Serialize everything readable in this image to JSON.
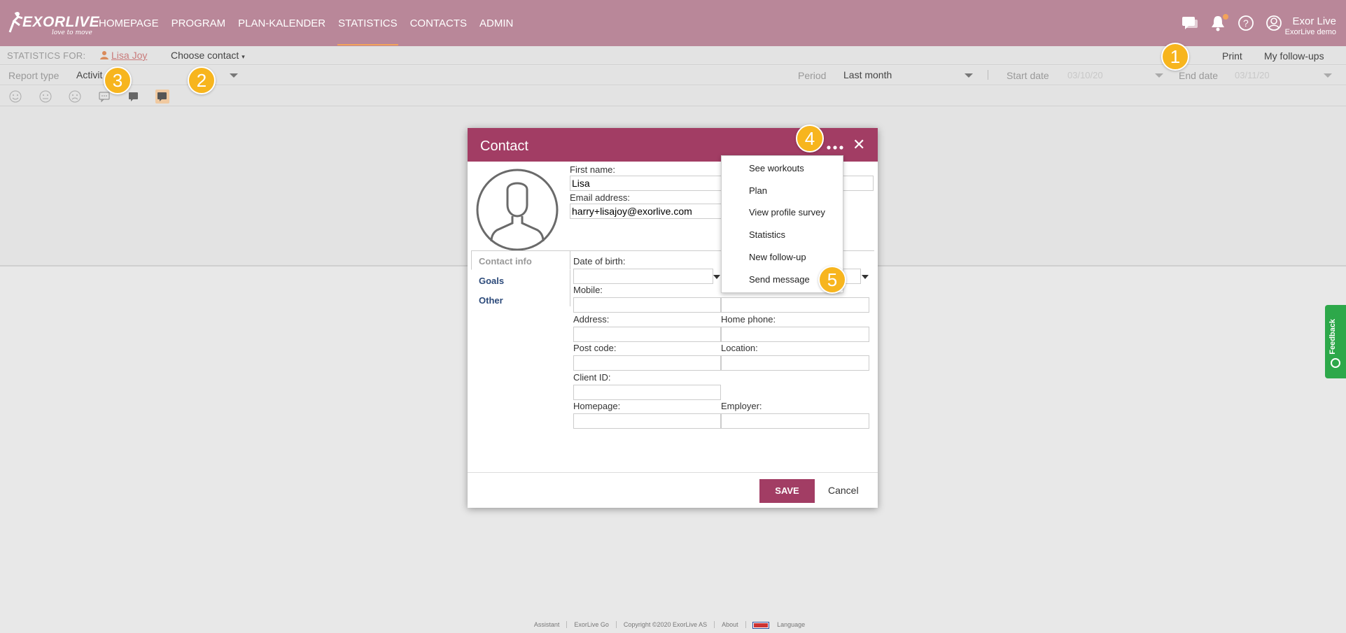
{
  "app": {
    "logo_text": "EXORLIVE",
    "logo_tagline": "love to move"
  },
  "nav": {
    "links": [
      "HOMEPAGE",
      "PROGRAM",
      "PLAN-KALENDER",
      "STATISTICS",
      "CONTACTS",
      "ADMIN"
    ],
    "active": "STATISTICS",
    "user_name": "Exor Live",
    "user_sub": "ExorLive demo"
  },
  "stats_bar": {
    "label": "STATISTICS FOR:",
    "contact": "Lisa Joy",
    "choose_contact": "Choose contact",
    "print": "Print",
    "follow_ups": "My follow-ups"
  },
  "report_row": {
    "report_type_label": "Report type",
    "report_type_value": "Activit",
    "period_label": "Period",
    "period_value": "Last month",
    "start_label": "Start date",
    "start_value": "03/10/20",
    "end_label": "End date",
    "end_value": "03/11/20"
  },
  "modal": {
    "title": "Contact",
    "first_name_label": "First name:",
    "first_name_value": "Lisa",
    "email_label": "Email address:",
    "email_value": "harry+lisajoy@exorlive.com",
    "tabs": {
      "contact_info": "Contact info",
      "goals": "Goals",
      "other": "Other"
    },
    "fields": {
      "dob": "Date of birth:",
      "mobile": "Mobile:",
      "address": "Address:",
      "home_phone": "Home phone:",
      "post_code": "Post code:",
      "location": "Location:",
      "client_id": "Client ID:",
      "homepage": "Homepage:",
      "employer": "Employer:"
    },
    "save": "SAVE",
    "cancel": "Cancel"
  },
  "menu": {
    "items": [
      "See workouts",
      "Plan",
      "View profile survey",
      "Statistics",
      "New follow-up",
      "Send message"
    ]
  },
  "badges": [
    "1",
    "2",
    "3",
    "4",
    "5"
  ],
  "feedback": "Feedback",
  "footer": [
    "Assistant",
    "ExorLive Go",
    "Copyright ©2020 ExorLive AS",
    "About",
    "Language"
  ],
  "colors": {
    "nav_bg": "#b98799",
    "modal_accent": "#a23d64",
    "badge": "#f7b51e",
    "feedback": "#2da84a"
  }
}
